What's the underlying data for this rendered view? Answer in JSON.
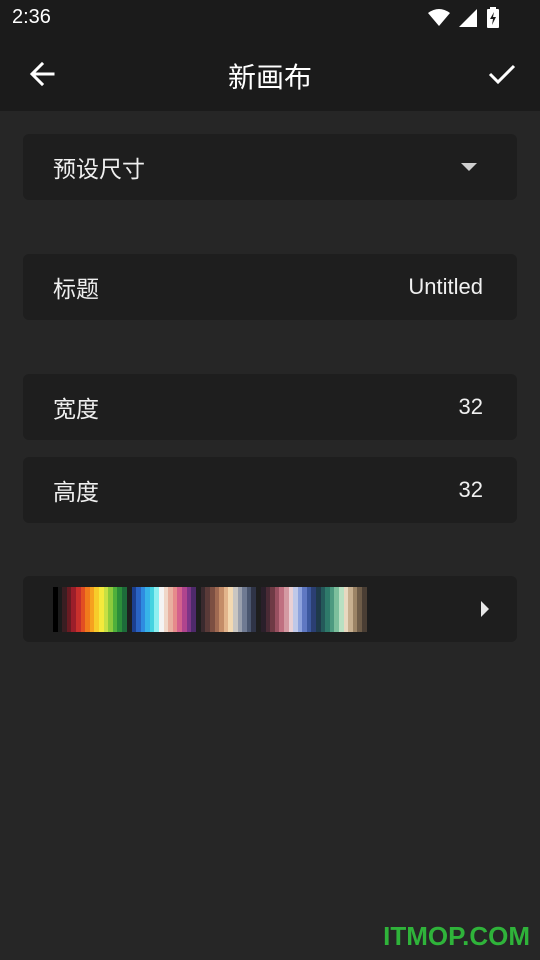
{
  "status_bar": {
    "time": "2:36",
    "icons": [
      "wifi-icon",
      "signal-icon",
      "battery-charging-icon"
    ]
  },
  "app_bar": {
    "title": "新画布",
    "back_icon": "arrow-left-icon",
    "confirm_icon": "check-icon"
  },
  "preset": {
    "label": "预设尺寸",
    "icon": "dropdown-triangle-icon"
  },
  "title_field": {
    "label": "标题",
    "value": "Untitled"
  },
  "width_field": {
    "label": "宽度",
    "value": "32"
  },
  "height_field": {
    "label": "高度",
    "value": "32"
  },
  "palette": {
    "icon": "chevron-right-icon",
    "groups": [
      [
        "#000000",
        "#1b1b1b",
        "#3a1e22",
        "#6a1b22",
        "#9b1e2a",
        "#c8302c",
        "#e24f22",
        "#f07a1c",
        "#f6a11f",
        "#f7cc2a",
        "#f5ea3c",
        "#c8e043",
        "#8dcb3c",
        "#4fb03b",
        "#2b8e3a",
        "#1d6b3a"
      ],
      [
        "#1c3f8f",
        "#2a63c3",
        "#2f8be0",
        "#37b3e8",
        "#45d3e0",
        "#8ef0f0",
        "#f4f4f4",
        "#f0d7c8",
        "#e8b0a0",
        "#e68b8b",
        "#d4618c",
        "#b0448e",
        "#7c3587",
        "#4e2a6b"
      ],
      [
        "#3a2a2e",
        "#5a3a38",
        "#7c4f42",
        "#a06a52",
        "#c48c68",
        "#e2b48c",
        "#f3d9b1",
        "#c9c6c2",
        "#9aa0ad",
        "#6f7a92",
        "#4a566f",
        "#2f3447"
      ],
      [
        "#2a1f2a",
        "#4a2a35",
        "#6e3a44",
        "#985060",
        "#c07080",
        "#d49aa2",
        "#ead0d4",
        "#bfc8e8",
        "#8ea3dd",
        "#5f78c2",
        "#3c589e",
        "#2b3f73",
        "#1f3a4a",
        "#245a5a",
        "#2e7a6a",
        "#4d9a80",
        "#7cbf9c",
        "#b8e0c2",
        "#e8d8c0",
        "#c8b090",
        "#9c8466",
        "#6e5c48",
        "#4a3e34"
      ]
    ]
  }
}
